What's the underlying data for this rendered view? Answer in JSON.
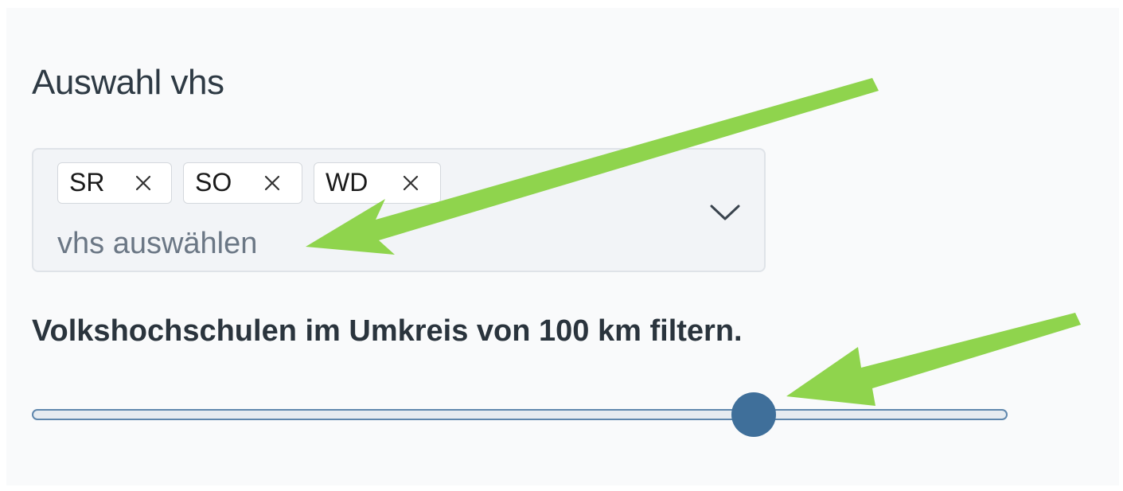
{
  "section": {
    "title": "Auswahl vhs"
  },
  "multiselect": {
    "tags": [
      {
        "label": "SR",
        "remove_icon": "close-icon"
      },
      {
        "label": "SO",
        "remove_icon": "close-icon"
      },
      {
        "label": "WD",
        "remove_icon": "close-icon"
      }
    ],
    "placeholder": "vhs auswählen",
    "dropdown_icon": "chevron-down-icon"
  },
  "radius_filter": {
    "label": "Volkshochschulen im Umkreis von 100 km filtern.",
    "slider_value_fraction": 0.74
  },
  "colors": {
    "annotation_arrow": "#8fd44d",
    "slider_thumb": "#3f6f9a",
    "slider_track_border": "#5f87ad"
  }
}
